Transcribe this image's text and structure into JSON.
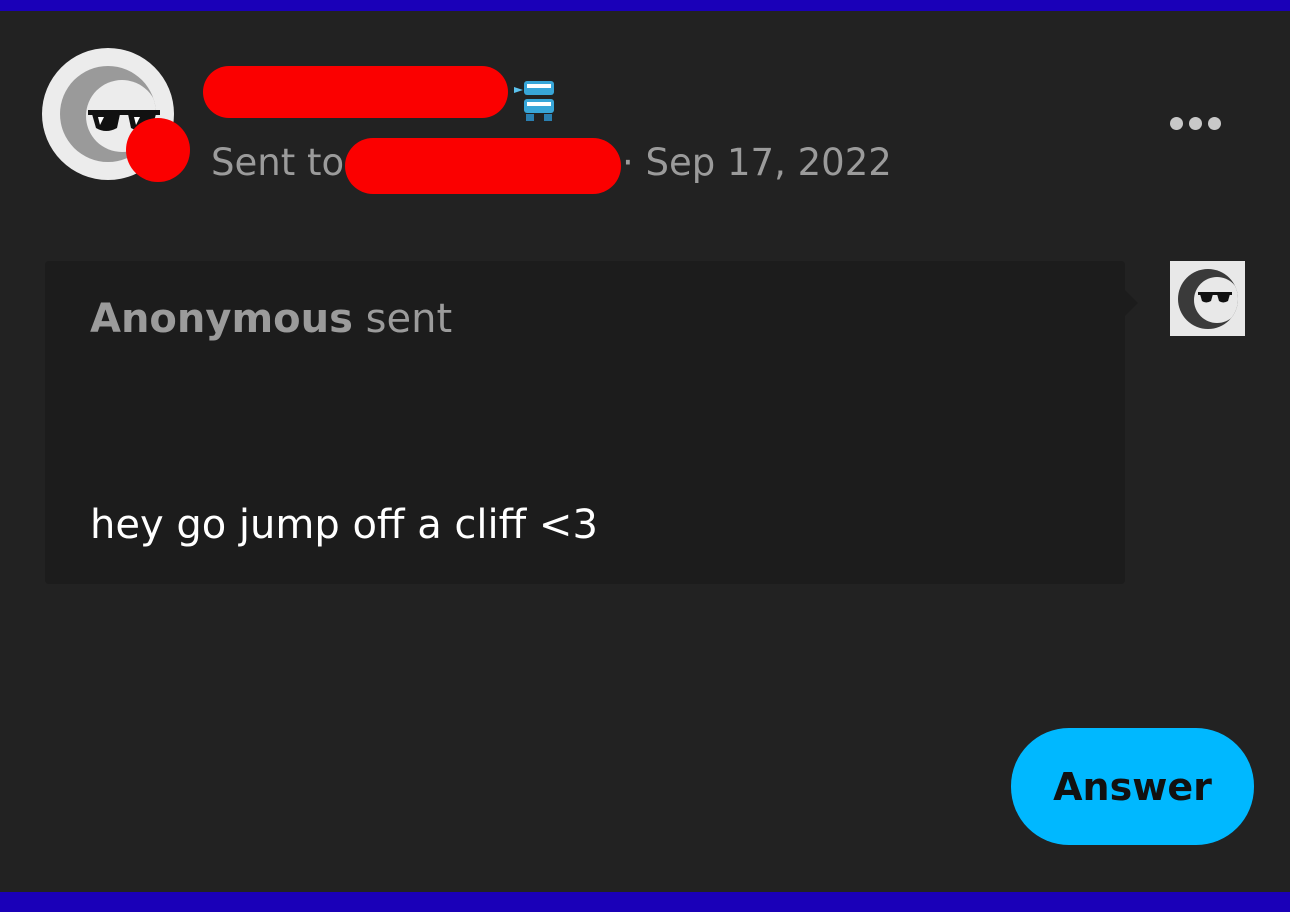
{
  "post": {
    "sent_to_label": "Sent to",
    "date": "· Sep 17, 2022",
    "more_icon": "more-horizontal-icon",
    "badge_icon": "chattering-teeth-icon"
  },
  "ask": {
    "sender": "Anonymous",
    "verb": "sent",
    "message": "hey go jump off a cliff <3",
    "avatar_icon": "anonymous-sunglasses-moon-icon"
  },
  "actions": {
    "answer_label": "Answer"
  },
  "colors": {
    "background": "#222222",
    "frame": "#1a00b8",
    "accent": "#00b8ff",
    "redaction": "#fb0000",
    "bubble": "#1c1c1c",
    "muted_text": "#9b9b9b"
  }
}
